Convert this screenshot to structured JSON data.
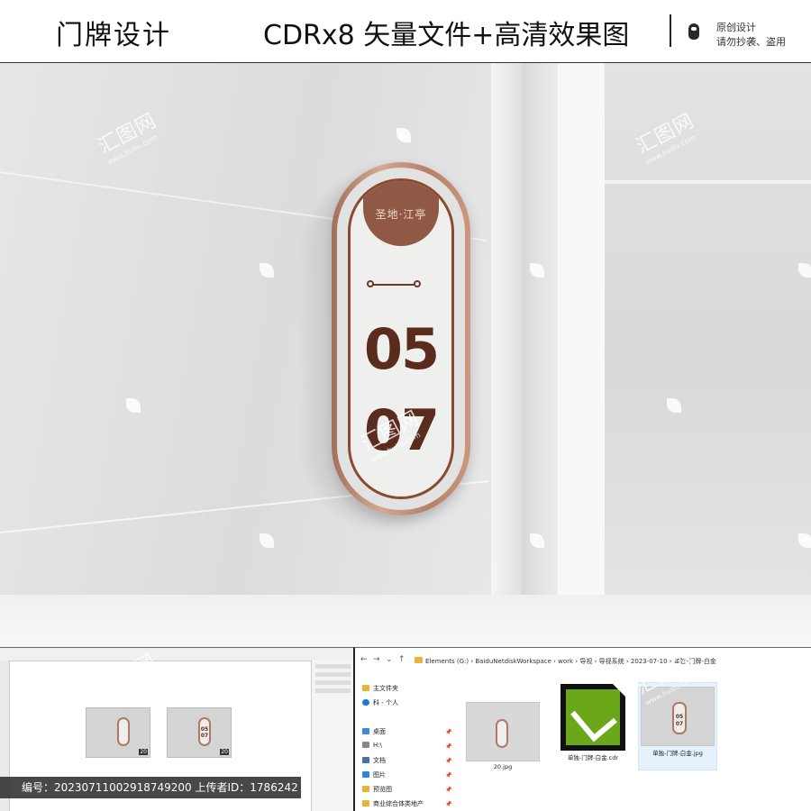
{
  "header": {
    "title": "门牌设计",
    "subtitle": "CDRx8 矢量文件+高清效果图",
    "notice_line1": "原创设计",
    "notice_line2": "请勿抄袭、盗用"
  },
  "sign": {
    "logo_text": "圣地·江亭",
    "number_top": "05",
    "number_bottom": "07",
    "accent_color": "#8f5945"
  },
  "watermark": {
    "text": "汇图网",
    "url": "www.huitu.com"
  },
  "explorer": {
    "breadcrumb": [
      "Elements (G:)",
      "BaiduNetdiskWorkspace",
      "work",
      "导视",
      "导视系统",
      "2023-07-10",
      "单独-门牌-白金"
    ],
    "nav_items": [
      {
        "label": "主文件夹",
        "color": "#e9b23a"
      },
      {
        "label": "科 - 个人",
        "color": "#1e7bd6"
      },
      {
        "label": "桌面",
        "color": "#3c8ad8"
      },
      {
        "label": "H:\\",
        "color": "#888888"
      },
      {
        "label": "文档",
        "color": "#4a6fa8"
      },
      {
        "label": "图片",
        "color": "#2f86d8"
      },
      {
        "label": "预览图",
        "color": "#e9b23a"
      },
      {
        "label": "商业综合体类地产",
        "color": "#e9b23a"
      }
    ],
    "files": [
      {
        "name": "20.jpg"
      },
      {
        "name": "单独-门牌-白金.cdr"
      },
      {
        "name": "单独-门牌-白金.jpg"
      }
    ]
  },
  "editor": {
    "thumb_tags": [
      "20",
      "20"
    ]
  },
  "id_strip": {
    "text": "编号：20230711002918749200  上传者ID：1786242"
  }
}
